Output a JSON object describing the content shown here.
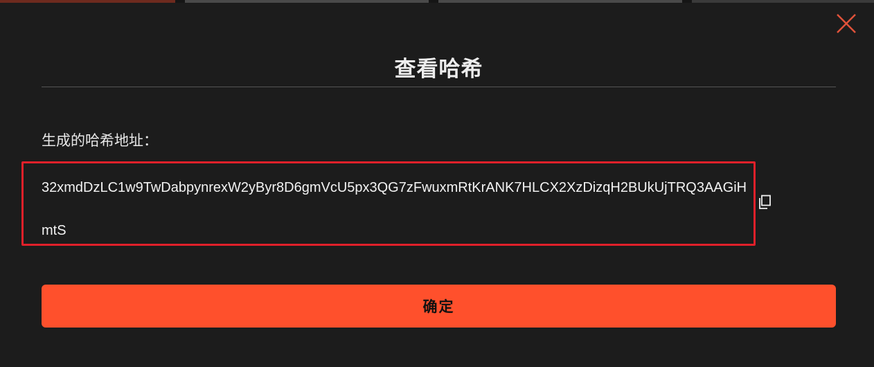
{
  "dialog": {
    "title": "查看哈希",
    "close_icon": "close-icon",
    "field_label": "生成的哈希地址：",
    "hash_value": "32xmdDzLC1w9TwDabpynrexW2yByr8D6gmVcU5px3QG7zFwuxmRtKrANK7HLCX2XzDizqH2BUkUjTRQ3AAGiHmtS",
    "copy_icon": "copy-icon",
    "confirm_label": "确定"
  },
  "colors": {
    "background": "#1c1c1c",
    "accent": "#ff502c",
    "highlight_border": "#e0202a",
    "close_icon": "#e0523a"
  }
}
